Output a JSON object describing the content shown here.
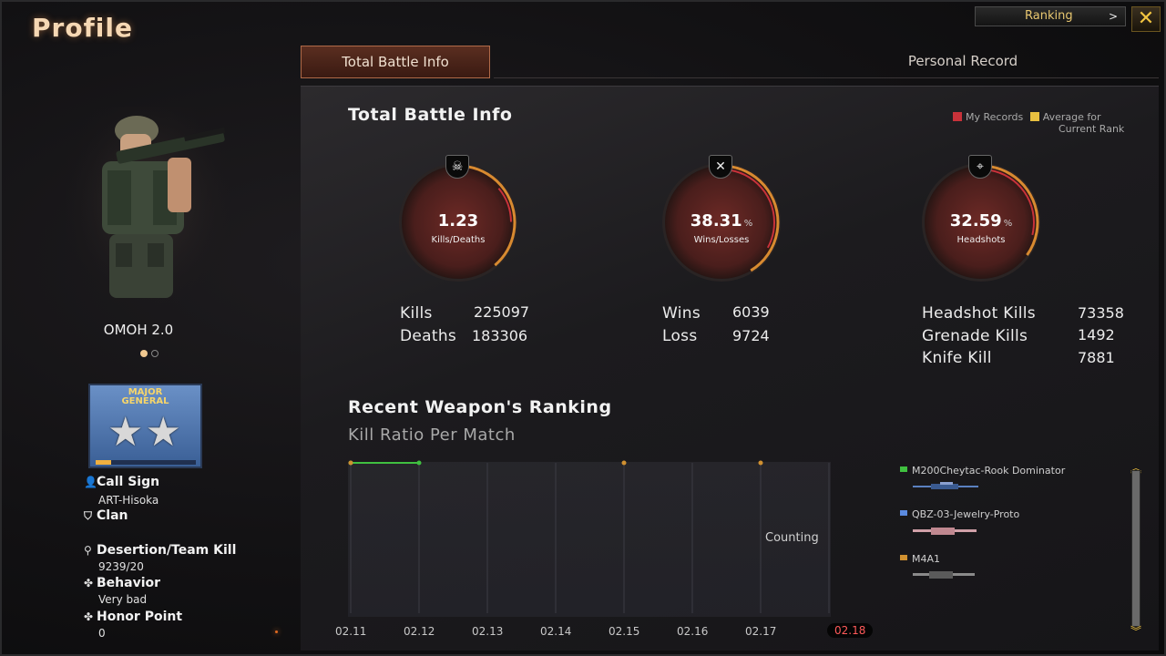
{
  "header": {
    "title": "Profile",
    "ranking_label": "Ranking",
    "ranking_chevron": ">",
    "close_glyph": "✕"
  },
  "tabs": [
    {
      "label": "Total Battle Info",
      "active": true
    },
    {
      "label": "Personal Record",
      "active": false
    }
  ],
  "character": {
    "name": "OMOH 2.0",
    "pager_dots": 2,
    "pager_active": 0
  },
  "rank": {
    "title_line1": "MAJOR",
    "title_line2": "GENERAL",
    "stars": "★★",
    "progress": 0.15
  },
  "player_info": {
    "call_sign_label": "Call Sign",
    "call_sign": "ART-Hisoka",
    "clan_label": "Clan",
    "desertion_label": "Desertion/Team Kill",
    "desertion": "9239/20",
    "behavior_label": "Behavior",
    "behavior": "Very bad",
    "honor_label": "Honor Point",
    "honor": "0"
  },
  "battle_info": {
    "title": "Total Battle Info",
    "legend": {
      "my_records": "My Records",
      "average_line1": "Average for",
      "average_line2": "Current Rank",
      "my_color": "#c8323a",
      "avg_color": "#e8c040"
    },
    "gauges": [
      {
        "value": "1.23",
        "unit": "",
        "label": "Kills/Deaths",
        "icon": "skull-icon",
        "glyph": "☠"
      },
      {
        "value": "38.31",
        "unit": "%",
        "label": "Wins/Losses",
        "icon": "crossed-guns-icon",
        "glyph": "✕"
      },
      {
        "value": "32.59",
        "unit": "%",
        "label": "Headshots",
        "icon": "crosshair-icon",
        "glyph": "⌖"
      }
    ],
    "stats": {
      "kills_label": "Kills",
      "kills": "225097",
      "deaths_label": "Deaths",
      "deaths": "183306",
      "wins_label": "Wins",
      "wins": "6039",
      "loss_label": "Loss",
      "loss": "9724",
      "headshot_label": "Headshot Kills",
      "headshot": "73358",
      "grenade_label": "Grenade Kills",
      "grenade": "1492",
      "knife_label": "Knife Kill",
      "knife": "7881"
    }
  },
  "weapon_ranking": {
    "title": "Recent Weapon's Ranking",
    "subtitle": "Kill Ratio Per Match",
    "counting_label": "Counting",
    "weapons": [
      {
        "name": "M200Cheytac-Rook Dominator",
        "color": "#40c040"
      },
      {
        "name": "QBZ-03-Jewelry-Proto",
        "color": "#5a8ae0"
      },
      {
        "name": "M4A1",
        "color": "#d09030"
      }
    ]
  },
  "chart_data": {
    "type": "line",
    "title": "Kill Ratio Per Match",
    "categories": [
      "02.11",
      "02.12",
      "02.13",
      "02.14",
      "02.15",
      "02.16",
      "02.17",
      "02.18"
    ],
    "selected_category": "02.18",
    "series": [
      {
        "name": "M200Cheytac-Rook Dominator",
        "color": "#40c040",
        "points": [
          {
            "x": "02.11",
            "y": 1
          },
          {
            "x": "02.12",
            "y": 1
          }
        ]
      },
      {
        "name": "M4A1",
        "color": "#d09030",
        "points": [
          {
            "x": "02.11",
            "y": 1
          },
          {
            "x": "02.15",
            "y": 1
          },
          {
            "x": "02.17",
            "y": 1
          }
        ]
      }
    ],
    "ylim": [
      0,
      1
    ],
    "grid": true
  },
  "colors": {
    "accent": "#f2c540",
    "tab_active_bg": "#4a2418",
    "selected_date": "#ff5a5a"
  }
}
